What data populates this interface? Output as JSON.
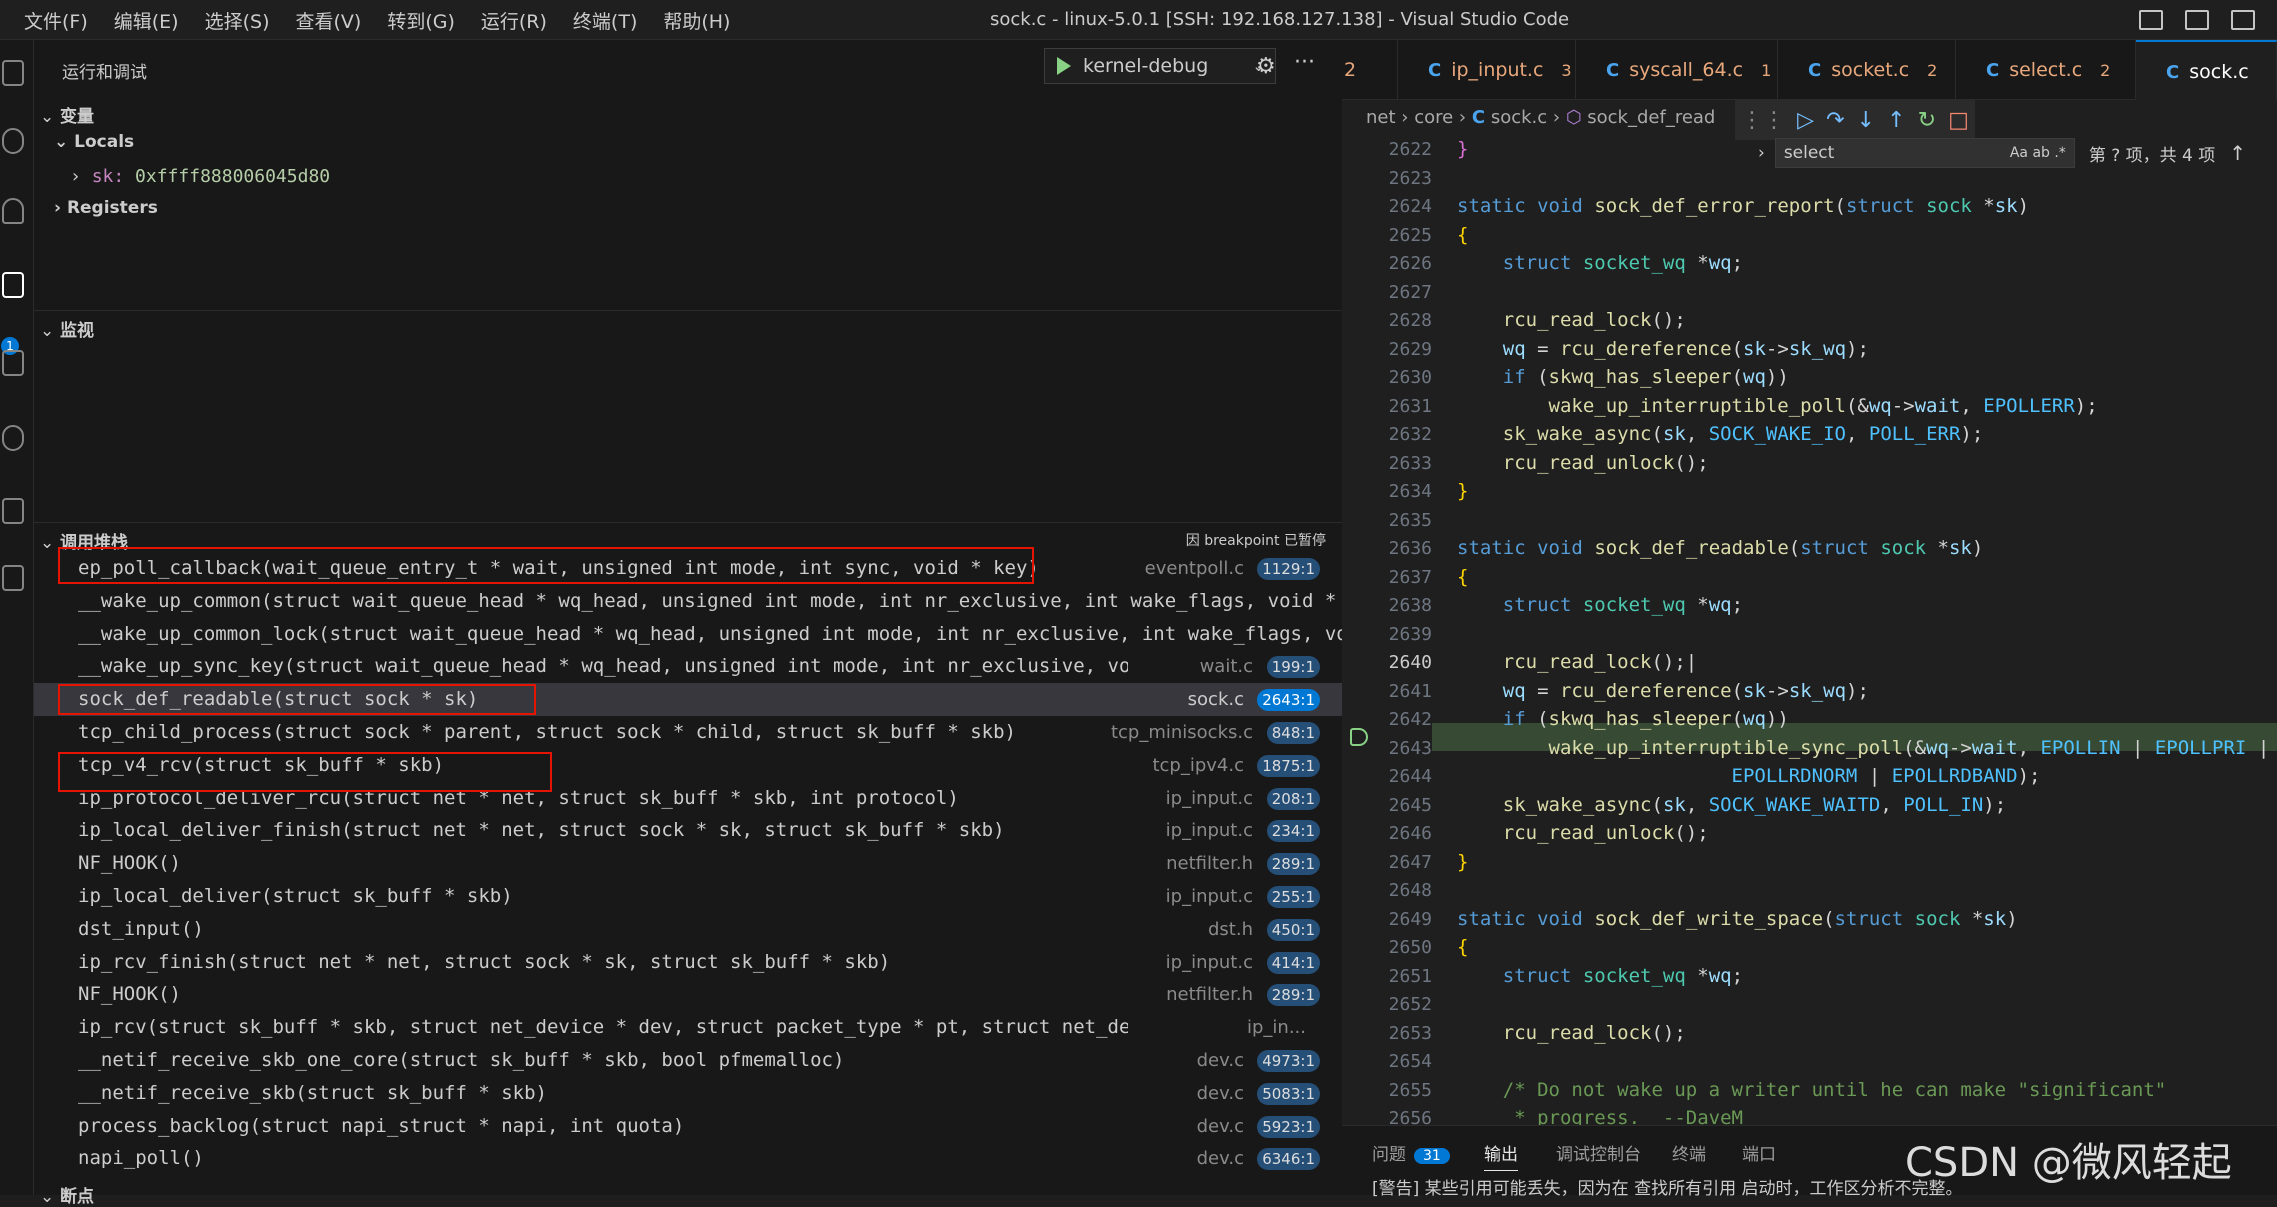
{
  "menu": [
    "文件(F)",
    "编辑(E)",
    "选择(S)",
    "查看(V)",
    "转到(G)",
    "运行(R)",
    "终端(T)",
    "帮助(H)"
  ],
  "window_title": "sock.c - linux-5.0.1 [SSH: 192.168.127.138] - Visual Studio Code",
  "activity": {
    "debug_badge": "1"
  },
  "sidebar": {
    "header": "运行和调试",
    "config": "kernel-debug",
    "variables": {
      "title": "变量",
      "locals": "Locals",
      "sk_name": "sk:",
      "sk_value": "0xffff888006045d80",
      "registers": "Registers"
    },
    "watch": {
      "title": "监视"
    },
    "callstack": {
      "title": "调用堆栈",
      "paused": "因 breakpoint 已暂停"
    },
    "breakpoints": {
      "title": "断点"
    }
  },
  "frames": [
    {
      "fn": "ep_poll_callback(wait_queue_entry_t * wait, unsigned int mode, int sync, void * key)",
      "file": "eventpoll.c",
      "line": "1129:1"
    },
    {
      "fn": "__wake_up_common(struct wait_queue_head * wq_head, unsigned int mode, int nr_exclusive, int wake_flags, void * key, wai",
      "file": "",
      "line": ""
    },
    {
      "fn": "__wake_up_common_lock(struct wait_queue_head * wq_head, unsigned int mode, int nr_exclusive, int wake_flags, void * ke",
      "file": "",
      "line": ""
    },
    {
      "fn": "__wake_up_sync_key(struct wait_queue_head * wq_head, unsigned int mode, int nr_exclusive, void * key)",
      "file": "wait.c",
      "line": "199:1"
    },
    {
      "fn": "sock_def_readable(struct sock * sk)",
      "file": "sock.c",
      "line": "2643:1"
    },
    {
      "fn": "tcp_child_process(struct sock * parent, struct sock * child, struct sk_buff * skb)",
      "file": "tcp_minisocks.c",
      "line": "848:1"
    },
    {
      "fn": "tcp_v4_rcv(struct sk_buff * skb)",
      "file": "tcp_ipv4.c",
      "line": "1875:1"
    },
    {
      "fn": "ip_protocol_deliver_rcu(struct net * net, struct sk_buff * skb, int protocol)",
      "file": "ip_input.c",
      "line": "208:1"
    },
    {
      "fn": "ip_local_deliver_finish(struct net * net, struct sock * sk, struct sk_buff * skb)",
      "file": "ip_input.c",
      "line": "234:1"
    },
    {
      "fn": "NF_HOOK()",
      "file": "netfilter.h",
      "line": "289:1"
    },
    {
      "fn": "ip_local_deliver(struct sk_buff * skb)",
      "file": "ip_input.c",
      "line": "255:1"
    },
    {
      "fn": "dst_input()",
      "file": "dst.h",
      "line": "450:1"
    },
    {
      "fn": "ip_rcv_finish(struct net * net, struct sock * sk, struct sk_buff * skb)",
      "file": "ip_input.c",
      "line": "414:1"
    },
    {
      "fn": "NF_HOOK()",
      "file": "netfilter.h",
      "line": "289:1"
    },
    {
      "fn": "ip_rcv(struct sk_buff * skb, struct net_device * dev, struct packet_type * pt, struct net_device * orig_dev)",
      "file": "ip_in...",
      "line": ""
    },
    {
      "fn": "__netif_receive_skb_one_core(struct sk_buff * skb, bool pfmemalloc)",
      "file": "dev.c",
      "line": "4973:1"
    },
    {
      "fn": "__netif_receive_skb(struct sk_buff * skb)",
      "file": "dev.c",
      "line": "5083:1"
    },
    {
      "fn": "process_backlog(struct napi_struct * napi, int quota)",
      "file": "dev.c",
      "line": "5923:1"
    },
    {
      "fn": "napi_poll()",
      "file": "dev.c",
      "line": "6346:1"
    }
  ],
  "tabs": [
    {
      "name": "2",
      "count": ""
    },
    {
      "name": "ip_input.c",
      "count": "3"
    },
    {
      "name": "syscall_64.c",
      "count": "1"
    },
    {
      "name": "socket.c",
      "count": "2"
    },
    {
      "name": "select.c",
      "count": "2"
    },
    {
      "name": "sock.c",
      "count": ""
    }
  ],
  "breadcrumb": {
    "p1": "net",
    "p2": "core",
    "file": "sock.c",
    "symbol": "sock_def_read"
  },
  "find": {
    "query": "select",
    "aa": "Aa",
    "ab": "ab",
    "re": ".*",
    "result": "第 ? 项，共 4 项"
  },
  "line_numbers": [
    "2622",
    "2623",
    "2624",
    "2625",
    "2626",
    "2627",
    "2628",
    "2629",
    "2630",
    "2631",
    "2632",
    "2633",
    "2634",
    "2635",
    "2636",
    "2637",
    "2638",
    "2639",
    "2640",
    "2641",
    "2642",
    "2643",
    "2644",
    "2645",
    "2646",
    "2647",
    "2648",
    "2649",
    "2650",
    "2651",
    "2652",
    "2653",
    "2654",
    "2655",
    "2656"
  ],
  "panel": {
    "problems": "问题",
    "problems_count": "31",
    "output": "输出",
    "debug_console": "调试控制台",
    "terminal": "终端",
    "ports": "端口",
    "message": "[警告] 某些引用可能丢失，因为在 查找所有引用 启动时，工作区分析不完整。"
  },
  "watermark": "CSDN @微风轻起"
}
